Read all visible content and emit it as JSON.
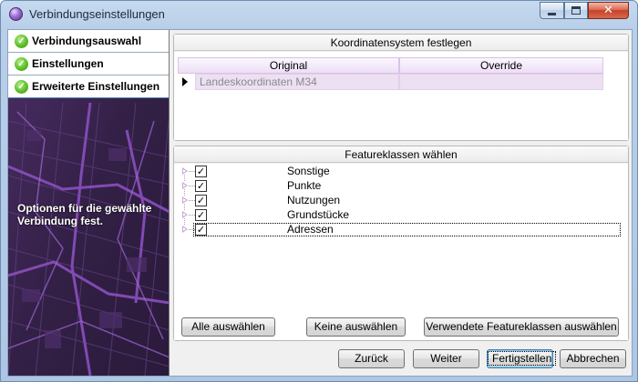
{
  "window": {
    "title": "Verbindungseinstellungen",
    "close_glyph": "✕"
  },
  "sidebar": {
    "steps": [
      {
        "label": "Verbindungsauswahl",
        "icon": "check-circle-icon"
      },
      {
        "label": "Einstellungen",
        "icon": "check-circle-icon"
      },
      {
        "label": "Erweiterte Einstellungen",
        "icon": "check-circle-icon"
      }
    ],
    "check_glyph": "✓",
    "description": "Optionen für die gewählte Verbindung fest."
  },
  "coordinate_group": {
    "title": "Koordinatensystem festlegen",
    "columns": [
      "Original",
      "Override"
    ],
    "rows": [
      {
        "original": "Landeskoordinaten M34",
        "override": ""
      }
    ]
  },
  "feature_group": {
    "title": "Featureklassen wählen",
    "items": [
      {
        "label": "Sonstige",
        "checked": true
      },
      {
        "label": "Punkte",
        "checked": true
      },
      {
        "label": "Nutzungen",
        "checked": true
      },
      {
        "label": "Grundstücke",
        "checked": true
      },
      {
        "label": "Adressen",
        "checked": true
      }
    ],
    "check_glyph": "✓",
    "buttons": {
      "select_all": "Alle auswählen",
      "select_none": "Keine auswählen",
      "select_used": "Verwendete Featureklassen auswählen"
    }
  },
  "footer": {
    "back": "Zurück",
    "next": "Weiter",
    "finish": "Fertigstellen",
    "cancel": "Abbrechen"
  },
  "colors": {
    "accent_purple": "#3c2252",
    "grid_header": "#eddff6"
  }
}
